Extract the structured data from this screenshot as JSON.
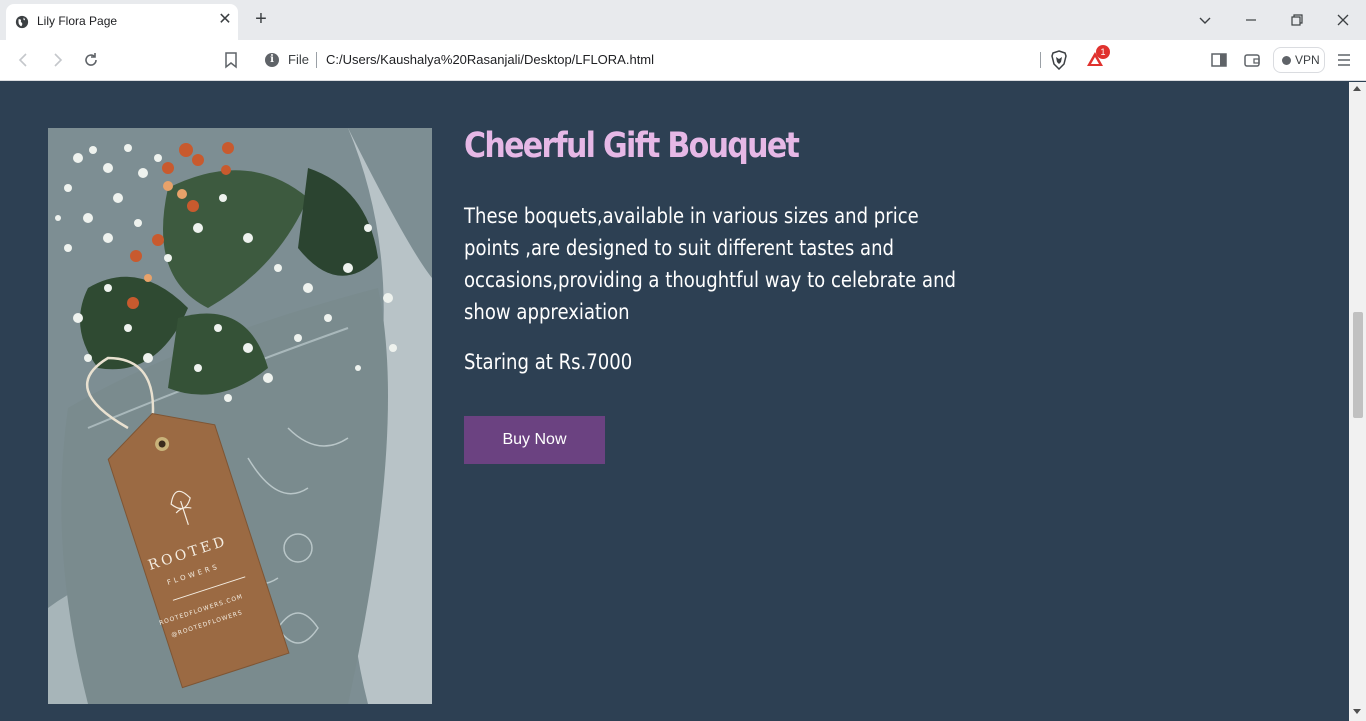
{
  "browser": {
    "tab": {
      "title": "Lily Flora Page",
      "close": "✕"
    },
    "new_tab": "+",
    "window": {
      "dropdown": "⌵",
      "minimize": "—",
      "restore": "❐",
      "close": "✕"
    },
    "address": {
      "scheme_label": "File",
      "url": "C:/Users/Kaushalya%20Rasanjali/Desktop/LFLORA.html"
    },
    "rewards_badge": "1",
    "vpn_label": "VPN"
  },
  "product": {
    "title": "Cheerful Gift Bouquet",
    "description": "These boquets,available in various sizes and price points ,are designed to suit different tastes and occasions,providing a thoughtful way to celebrate and show apprexiation",
    "price": "Staring at Rs.7000",
    "buy_label": "Buy Now",
    "tag_brand": "ROOTED",
    "tag_sub": "FLOWERS",
    "tag_site": "ROOTEDFLOWERS.COM",
    "tag_handle": "@ROOTEDFLOWERS"
  },
  "colors": {
    "page_bg": "#2d4053",
    "title": "#e6b8e6",
    "button": "#6b4281"
  }
}
